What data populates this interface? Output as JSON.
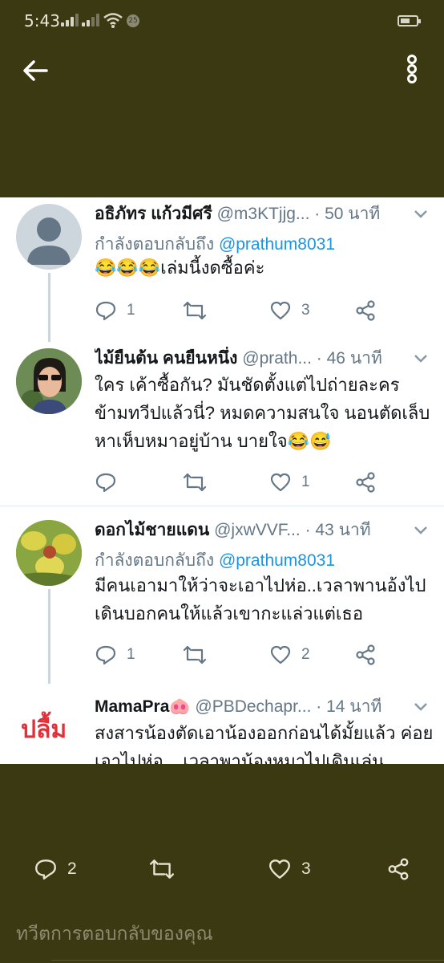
{
  "status_bar": {
    "time": "5:43",
    "notification_count": "25",
    "battery_level": 0.5
  },
  "header": {
    "back_icon": "arrow-left-icon",
    "more_icon": "more-vertical-icon"
  },
  "replying_to_label": "กำลังตอบกลับถึง",
  "tweets": [
    {
      "name": "อธิภัทร แก้วมีศรี",
      "handle": "@m3KTjjg...",
      "time": "· 50 นาที",
      "reply_to": "@prathum8031",
      "text": "😂😂😂เล่มนี้งดซื้อค่ะ",
      "replies": "1",
      "retweets": "",
      "likes": "3"
    },
    {
      "name": "ไม้ยืนต้น คนยืนหนึ่ง",
      "handle": "@prath...",
      "time": "· 46 นาที",
      "text": "ใคร เค้าซื้อกัน? มันชัดตั้งแต่ไปถ่ายละคร ข้ามทวีปแล้วนี่? หมดความสนใจ นอนตัดเล็บ หาเห็บหมาอยู่บ้าน บายใจ😂😅",
      "replies": "",
      "retweets": "",
      "likes": "1"
    },
    {
      "name": "ดอกไม้ชายแดน",
      "handle": "@jxwVVF...",
      "time": "· 43 นาที",
      "reply_to": "@prathum8031",
      "text": "มีคนเอามาให้ว่าจะเอาไปห่อ..เวลาพานอ้งไป เดินบอกคนให้แล้วเขากะแล่วแต่เธอ",
      "replies": "1",
      "retweets": "",
      "likes": "2"
    },
    {
      "name": "MamaPra🐽",
      "handle": "@PBDechapr...",
      "time": "· 14 นาที",
      "text": "สงสารน้องตัดเอาน้องออกก่อนได้มั้ยแล้ว ค่อยเอาไปห่อ... เวลาพาน้องหมาไปเดินเล่น",
      "side_label": "ปลื้ม"
    }
  ],
  "main_tweet_actions": {
    "replies": "2",
    "retweets": "",
    "likes": "3"
  },
  "reply_input": {
    "placeholder": "ทวีตการตอบกลับของคุณ"
  },
  "colors": {
    "background": "#3b3911",
    "link": "#1b95e0",
    "muted": "#657786",
    "accent_label": "#e0313a"
  }
}
